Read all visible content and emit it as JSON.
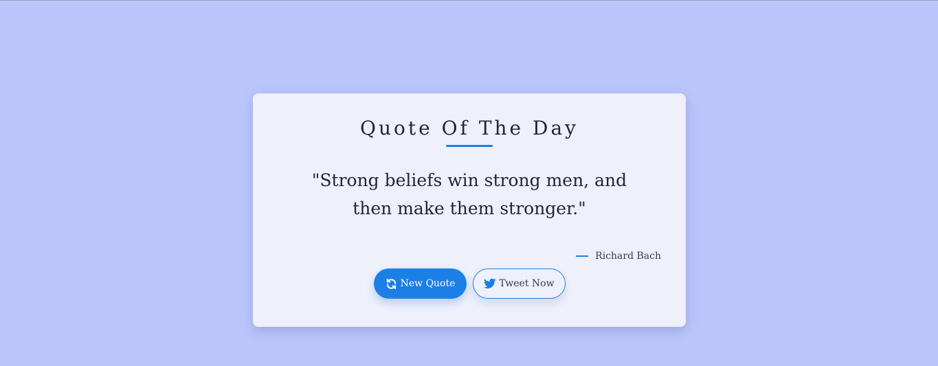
{
  "card": {
    "title": "Quote Of The Day",
    "quote": "\"Strong beliefs win strong men, and then make them stronger.\"",
    "author": "Richard Bach"
  },
  "buttons": {
    "new_quote": {
      "label": "New Quote",
      "icon": "refresh-icon"
    },
    "tweet": {
      "label": "Tweet Now",
      "icon": "twitter-icon"
    }
  },
  "colors": {
    "background": "#bac6fb",
    "card": "#eef0fc",
    "accent": "#1c7fe6",
    "text": "#23262e"
  }
}
